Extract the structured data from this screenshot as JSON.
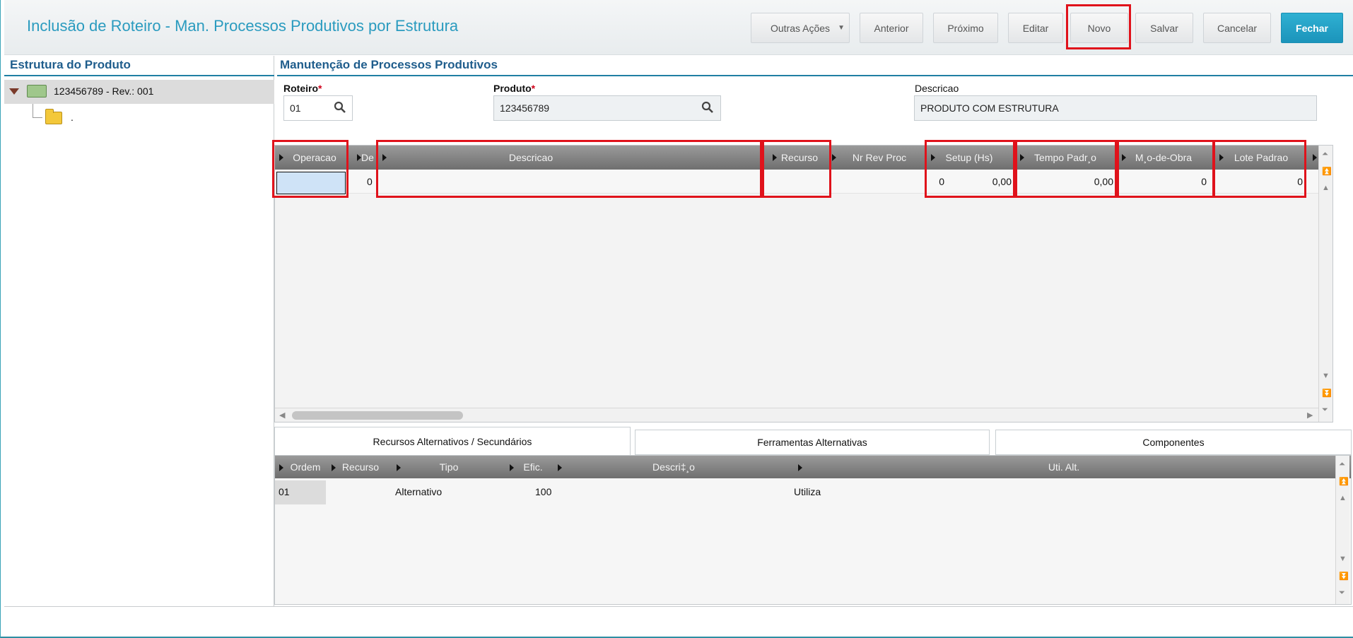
{
  "header": {
    "title": "Inclusão de Roteiro - Man. Processos Produtivos por Estrutura",
    "buttons": {
      "outras_acoes": "Outras Ações",
      "anterior": "Anterior",
      "proximo": "Próximo",
      "editar": "Editar",
      "novo": "Novo",
      "salvar": "Salvar",
      "cancelar": "Cancelar",
      "fechar": "Fechar"
    }
  },
  "left_panel": {
    "title": "Estrutura do Produto",
    "tree": {
      "root_label": "123456789 - Rev.: 001",
      "child_label": "."
    }
  },
  "main": {
    "title": "Manutenção de Processos Produtivos",
    "fields": {
      "roteiro": {
        "label": "Roteiro",
        "required": "*",
        "value": "01"
      },
      "produto": {
        "label": "Produto",
        "required": "*",
        "value": "123456789"
      },
      "descricao": {
        "label": "Descricao",
        "value": "PRODUTO COM ESTRUTURA"
      }
    },
    "grid": {
      "columns": [
        "Operacao",
        "Des",
        "Descricao",
        "Recurso",
        "Nr Rev Proc",
        "Setup (Hs)",
        "Tempo Padr¸o",
        "M¸o-de-Obra",
        "Lote Padrao"
      ],
      "row": [
        "",
        "0",
        "",
        "",
        "0",
        "0,00",
        "0,00",
        "0",
        "0"
      ]
    }
  },
  "tabs": [
    "Recursos Alternativos / Secundários",
    "Ferramentas Alternativas",
    "Componentes"
  ],
  "sub_grid": {
    "columns": [
      "Ordem",
      "Recurso",
      "Tipo",
      "Efic.",
      "Descri‡¸o",
      "Uti. Alt."
    ],
    "row": [
      "01",
      "",
      "Alternativo",
      "100",
      "",
      "Utiliza"
    ]
  },
  "colors": {
    "accent": "#2a9bbf",
    "primary_button": "#1b94bb",
    "highlight": "#e0121b"
  }
}
